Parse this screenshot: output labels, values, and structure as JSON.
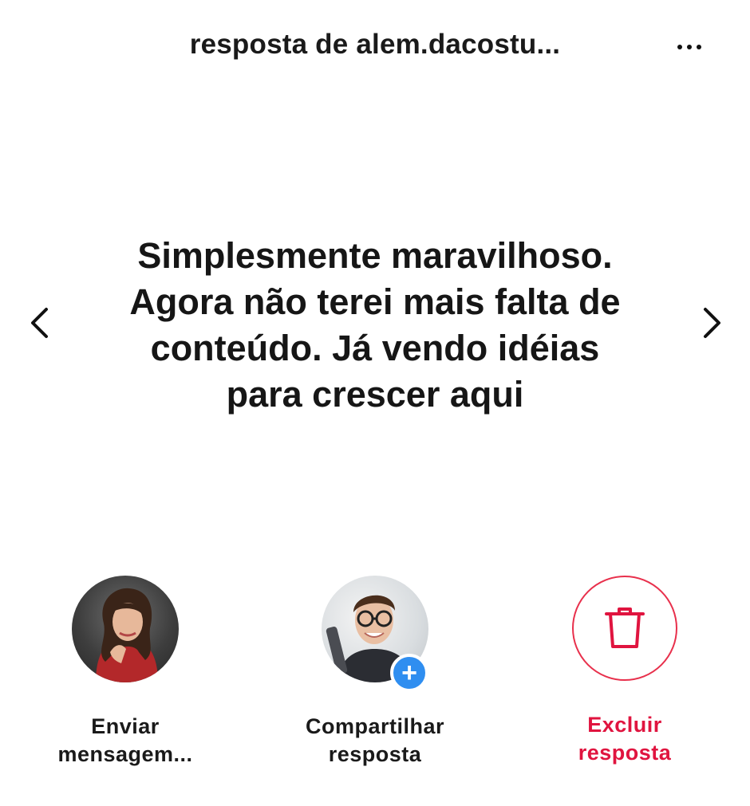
{
  "header": {
    "title": "resposta de alem.dacostu...",
    "more_icon": "more-horizontal-icon"
  },
  "navigation": {
    "prev_icon": "chevron-left-icon",
    "next_icon": "chevron-right-icon"
  },
  "message": {
    "lines": [
      "Simplesmente maravilhoso.",
      "Agora não terei mais falta de",
      "conteúdo. Já vendo idéias",
      "para crescer aqui"
    ]
  },
  "actions": [
    {
      "label_line1": "Enviar",
      "label_line2": "mensagem...",
      "icon": "user-avatar"
    },
    {
      "label_line1": "Compartilhar",
      "label_line2": "resposta",
      "icon": "add-badge-icon"
    },
    {
      "label_line1": "Excluir",
      "label_line2": "resposta",
      "icon": "trash-icon",
      "color": "#e0143f"
    }
  ],
  "colors": {
    "danger": "#e0143f",
    "badge": "#2f8ef0"
  }
}
